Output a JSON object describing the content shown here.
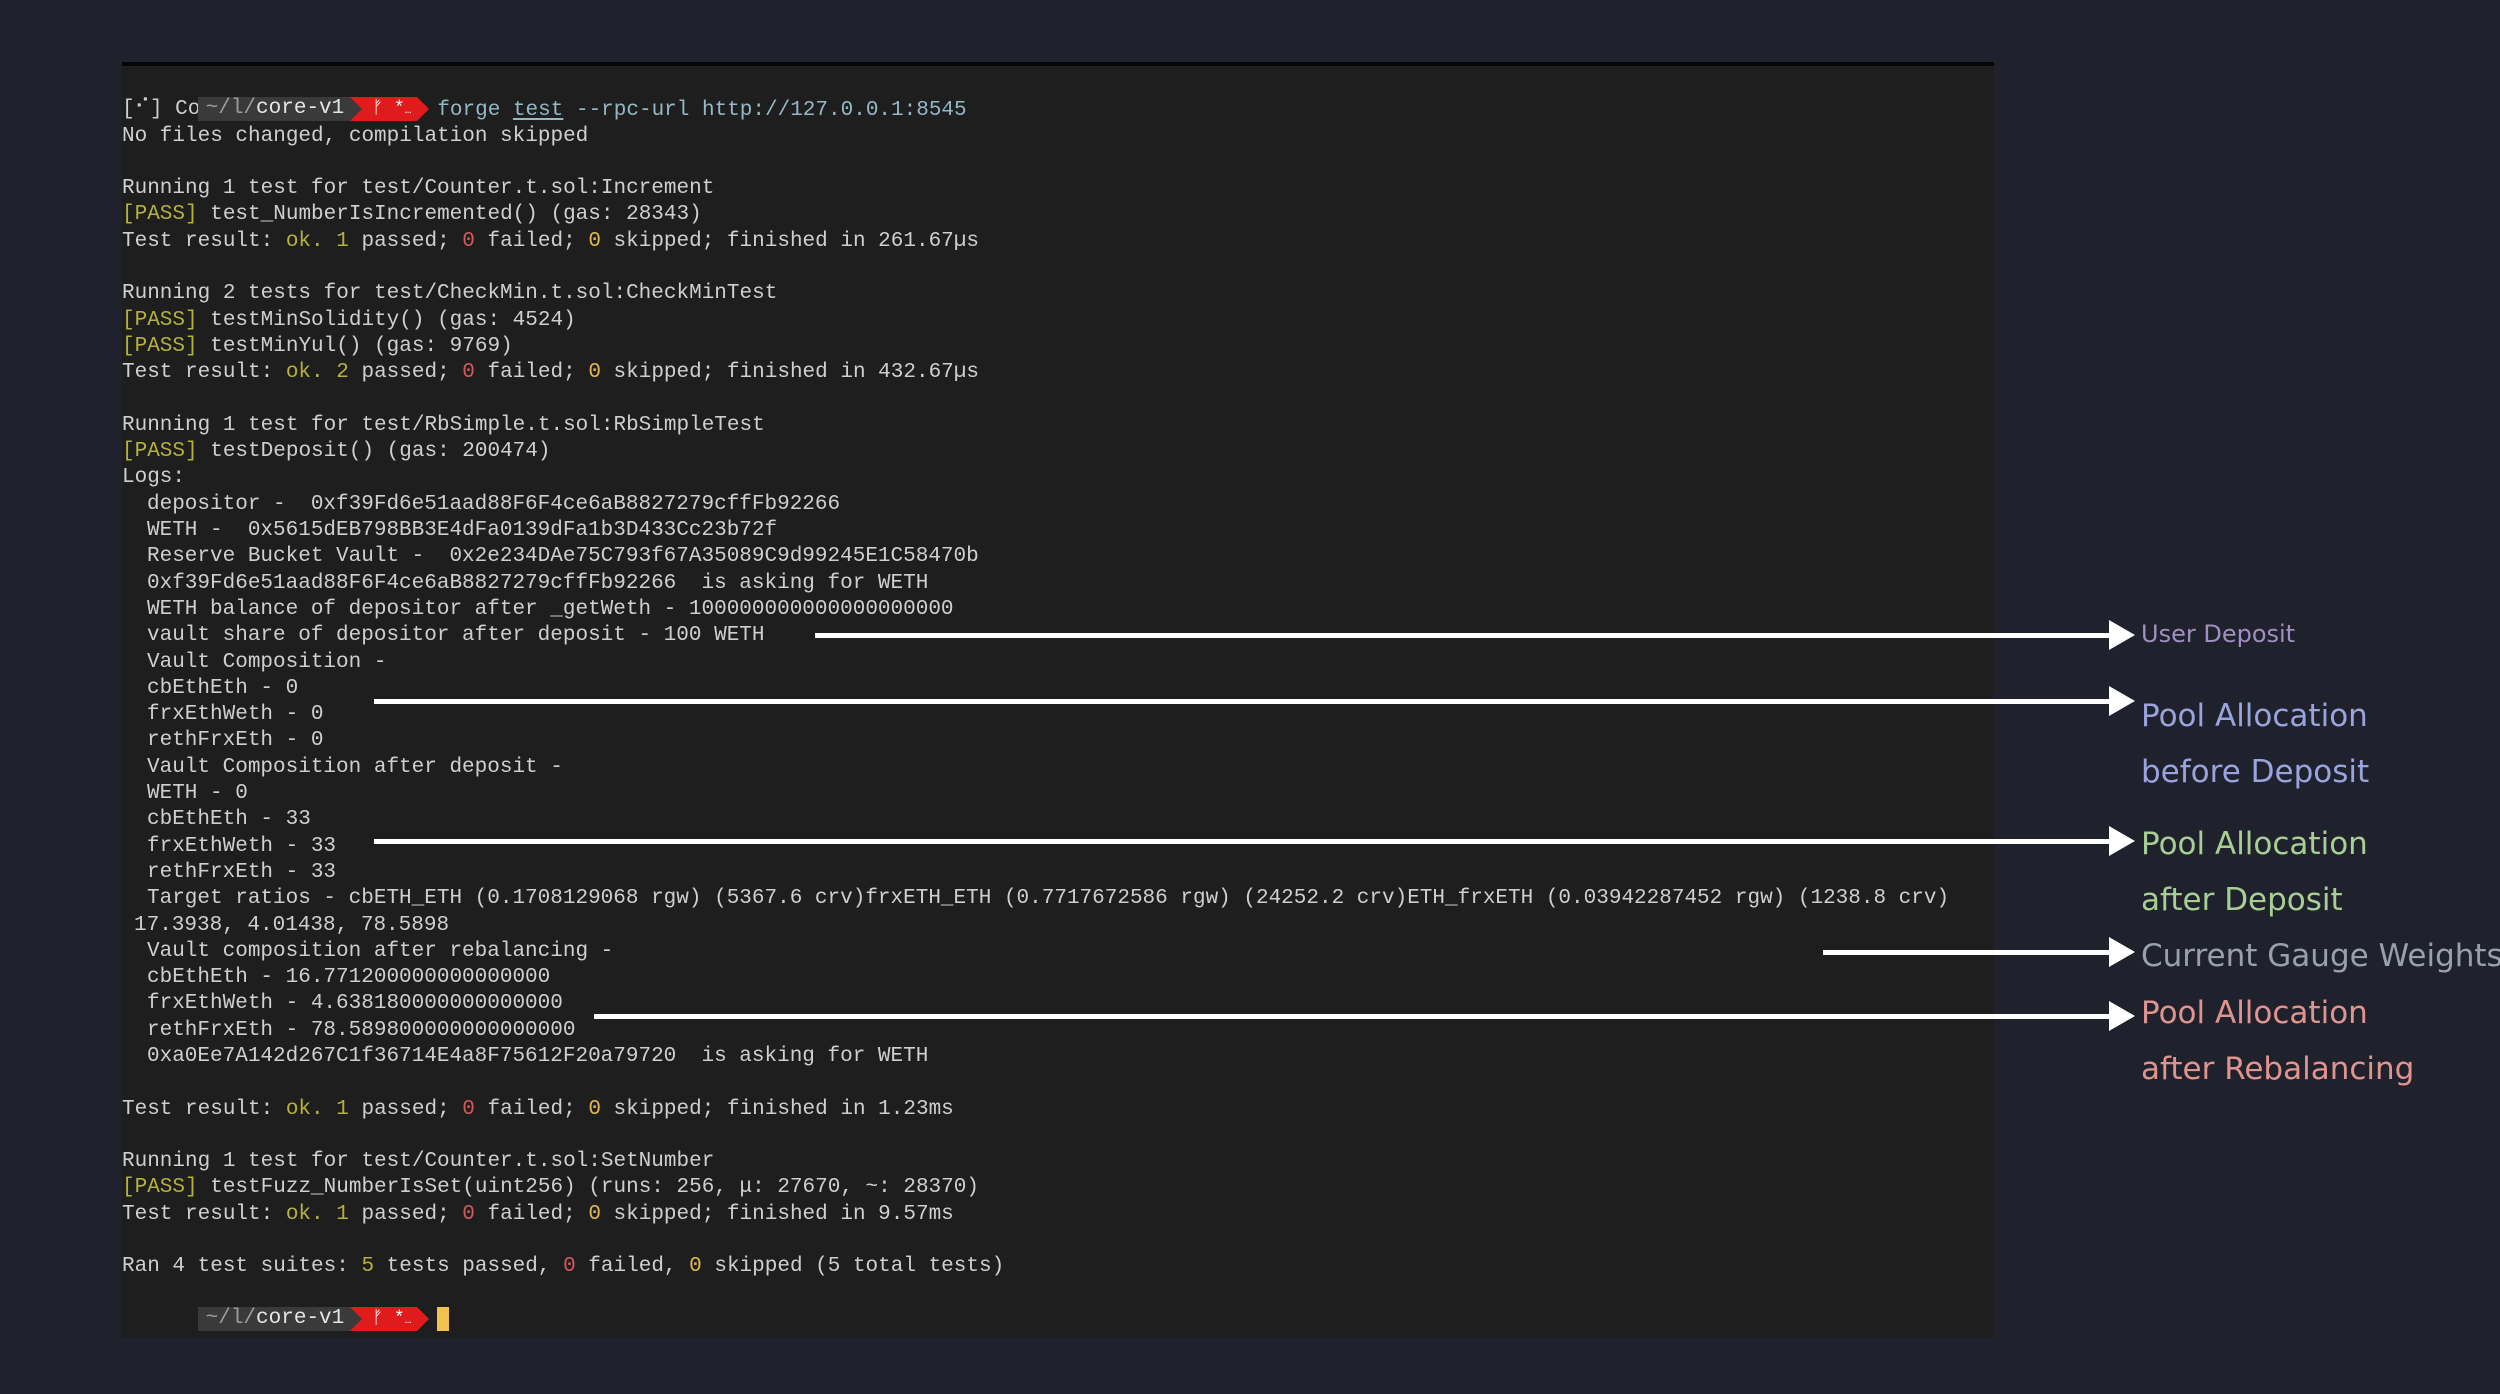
{
  "prompt": {
    "path_prefix": "~/l/",
    "path_dir": "core-v1",
    "git_branch_icon": "ᚠ",
    "git_status": "*",
    "git_ellipsis": "…"
  },
  "command": {
    "program": "forge",
    "subcommand": "test",
    "args": "--rpc-url http://127.0.0.1:8545"
  },
  "output": {
    "compiling": "[⠊] Compiling...",
    "no_changes": "No files changed, compilation skipped",
    "suites": [
      {
        "header": "Running 1 test for test/Counter.t.sol:Increment",
        "tests": [
          {
            "status": "[PASS]",
            "text": " test_NumberIsIncremented() (gas: 28343)"
          }
        ],
        "result": {
          "prefix": "Test result: ",
          "ok": "ok.",
          "passed_n": "1",
          "passed_t": " passed; ",
          "failed_n": "0",
          "failed_t": " failed; ",
          "skipped_n": "0",
          "skipped_t": " skipped; finished in 261.67µs"
        }
      },
      {
        "header": "Running 2 tests for test/CheckMin.t.sol:CheckMinTest",
        "tests": [
          {
            "status": "[PASS]",
            "text": " testMinSolidity() (gas: 4524)"
          },
          {
            "status": "[PASS]",
            "text": " testMinYul() (gas: 9769)"
          }
        ],
        "result": {
          "prefix": "Test result: ",
          "ok": "ok.",
          "passed_n": "2",
          "passed_t": " passed; ",
          "failed_n": "0",
          "failed_t": " failed; ",
          "skipped_n": "0",
          "skipped_t": " skipped; finished in 432.67µs"
        }
      },
      {
        "header": "Running 1 test for test/RbSimple.t.sol:RbSimpleTest",
        "tests": [
          {
            "status": "[PASS]",
            "text": " testDeposit() (gas: 200474)"
          }
        ],
        "logs_label": "Logs:",
        "logs": [
          "depositor -  0xf39Fd6e51aad88F6F4ce6aB8827279cffFb92266",
          "WETH -  0x5615dEB798BB3E4dFa0139dFa1b3D433Cc23b72f",
          "Reserve Bucket Vault -  0x2e234DAe75C793f67A35089C9d99245E1C58470b",
          "0xf39Fd6e51aad88F6F4ce6aB8827279cffFb92266  is asking for WETH",
          "WETH balance of depositor after _getWeth - 100000000000000000000",
          "vault share of depositor after deposit - 100 WETH",
          "Vault Composition -",
          "cbEthEth - 0",
          "frxEthWeth - 0",
          "rethFrxEth - 0",
          "Vault Composition after deposit -",
          "WETH - 0",
          "cbEthEth - 33",
          "frxEthWeth - 33",
          "rethFrxEth - 33",
          "Target ratios - cbETH_ETH (0.1708129068 rgw) (5367.6 crv)frxETH_ETH (0.7717672586 rgw) (24252.2 crv)ETH_frxETH (0.03942287452 rgw) (1238.8 crv)",
          "17.3938, 4.01438, 78.5898",
          "Vault composition after rebalancing -",
          "cbEthEth - 16.771200000000000000",
          "frxEthWeth - 4.638180000000000000",
          "rethFrxEth - 78.589800000000000000",
          "0xa0Ee7A142d267C1f36714E4a8F75612F20a79720  is asking for WETH"
        ],
        "result": {
          "prefix": "Test result: ",
          "ok": "ok.",
          "passed_n": "1",
          "passed_t": " passed; ",
          "failed_n": "0",
          "failed_t": " failed; ",
          "skipped_n": "0",
          "skipped_t": " skipped; finished in 1.23ms"
        }
      },
      {
        "header": "Running 1 test for test/Counter.t.sol:SetNumber",
        "tests": [
          {
            "status": "[PASS]",
            "text": " testFuzz_NumberIsSet(uint256) (runs: 256, μ: 27670, ~: 28370)"
          }
        ],
        "result": {
          "prefix": "Test result: ",
          "ok": "ok.",
          "passed_n": "1",
          "passed_t": " passed; ",
          "failed_n": "0",
          "failed_t": " failed; ",
          "skipped_n": "0",
          "skipped_t": " skipped; finished in 9.57ms"
        }
      }
    ],
    "summary": {
      "prefix": "Ran 4 test suites: ",
      "passed_n": "5",
      "passed_t": " tests passed, ",
      "failed_n": "0",
      "failed_t": " failed, ",
      "skipped_n": "0",
      "skipped_t": " skipped (5 total tests)"
    }
  },
  "annotations": [
    {
      "lines": [
        "User Deposit"
      ],
      "color": "#a08fc0"
    },
    {
      "lines": [
        "Pool Allocation",
        "before Deposit"
      ],
      "color": "#9aa3de"
    },
    {
      "lines": [
        "Pool Allocation",
        "after Deposit"
      ],
      "color": "#a7cf94"
    },
    {
      "lines": [
        "Current Gauge Weights"
      ],
      "color": "#9aa0ab"
    },
    {
      "lines": [
        "Pool Allocation",
        "after Rebalancing"
      ],
      "color": "#e0948e"
    }
  ],
  "colors": {
    "background": "#1f222c",
    "terminal_bg": "#1e1e1f",
    "pass": "#b5b23c",
    "failed_zero": "#d7575b",
    "skipped_zero": "#e3b84a",
    "git_segment": "#e01b1b",
    "cursor": "#f2c14e"
  }
}
